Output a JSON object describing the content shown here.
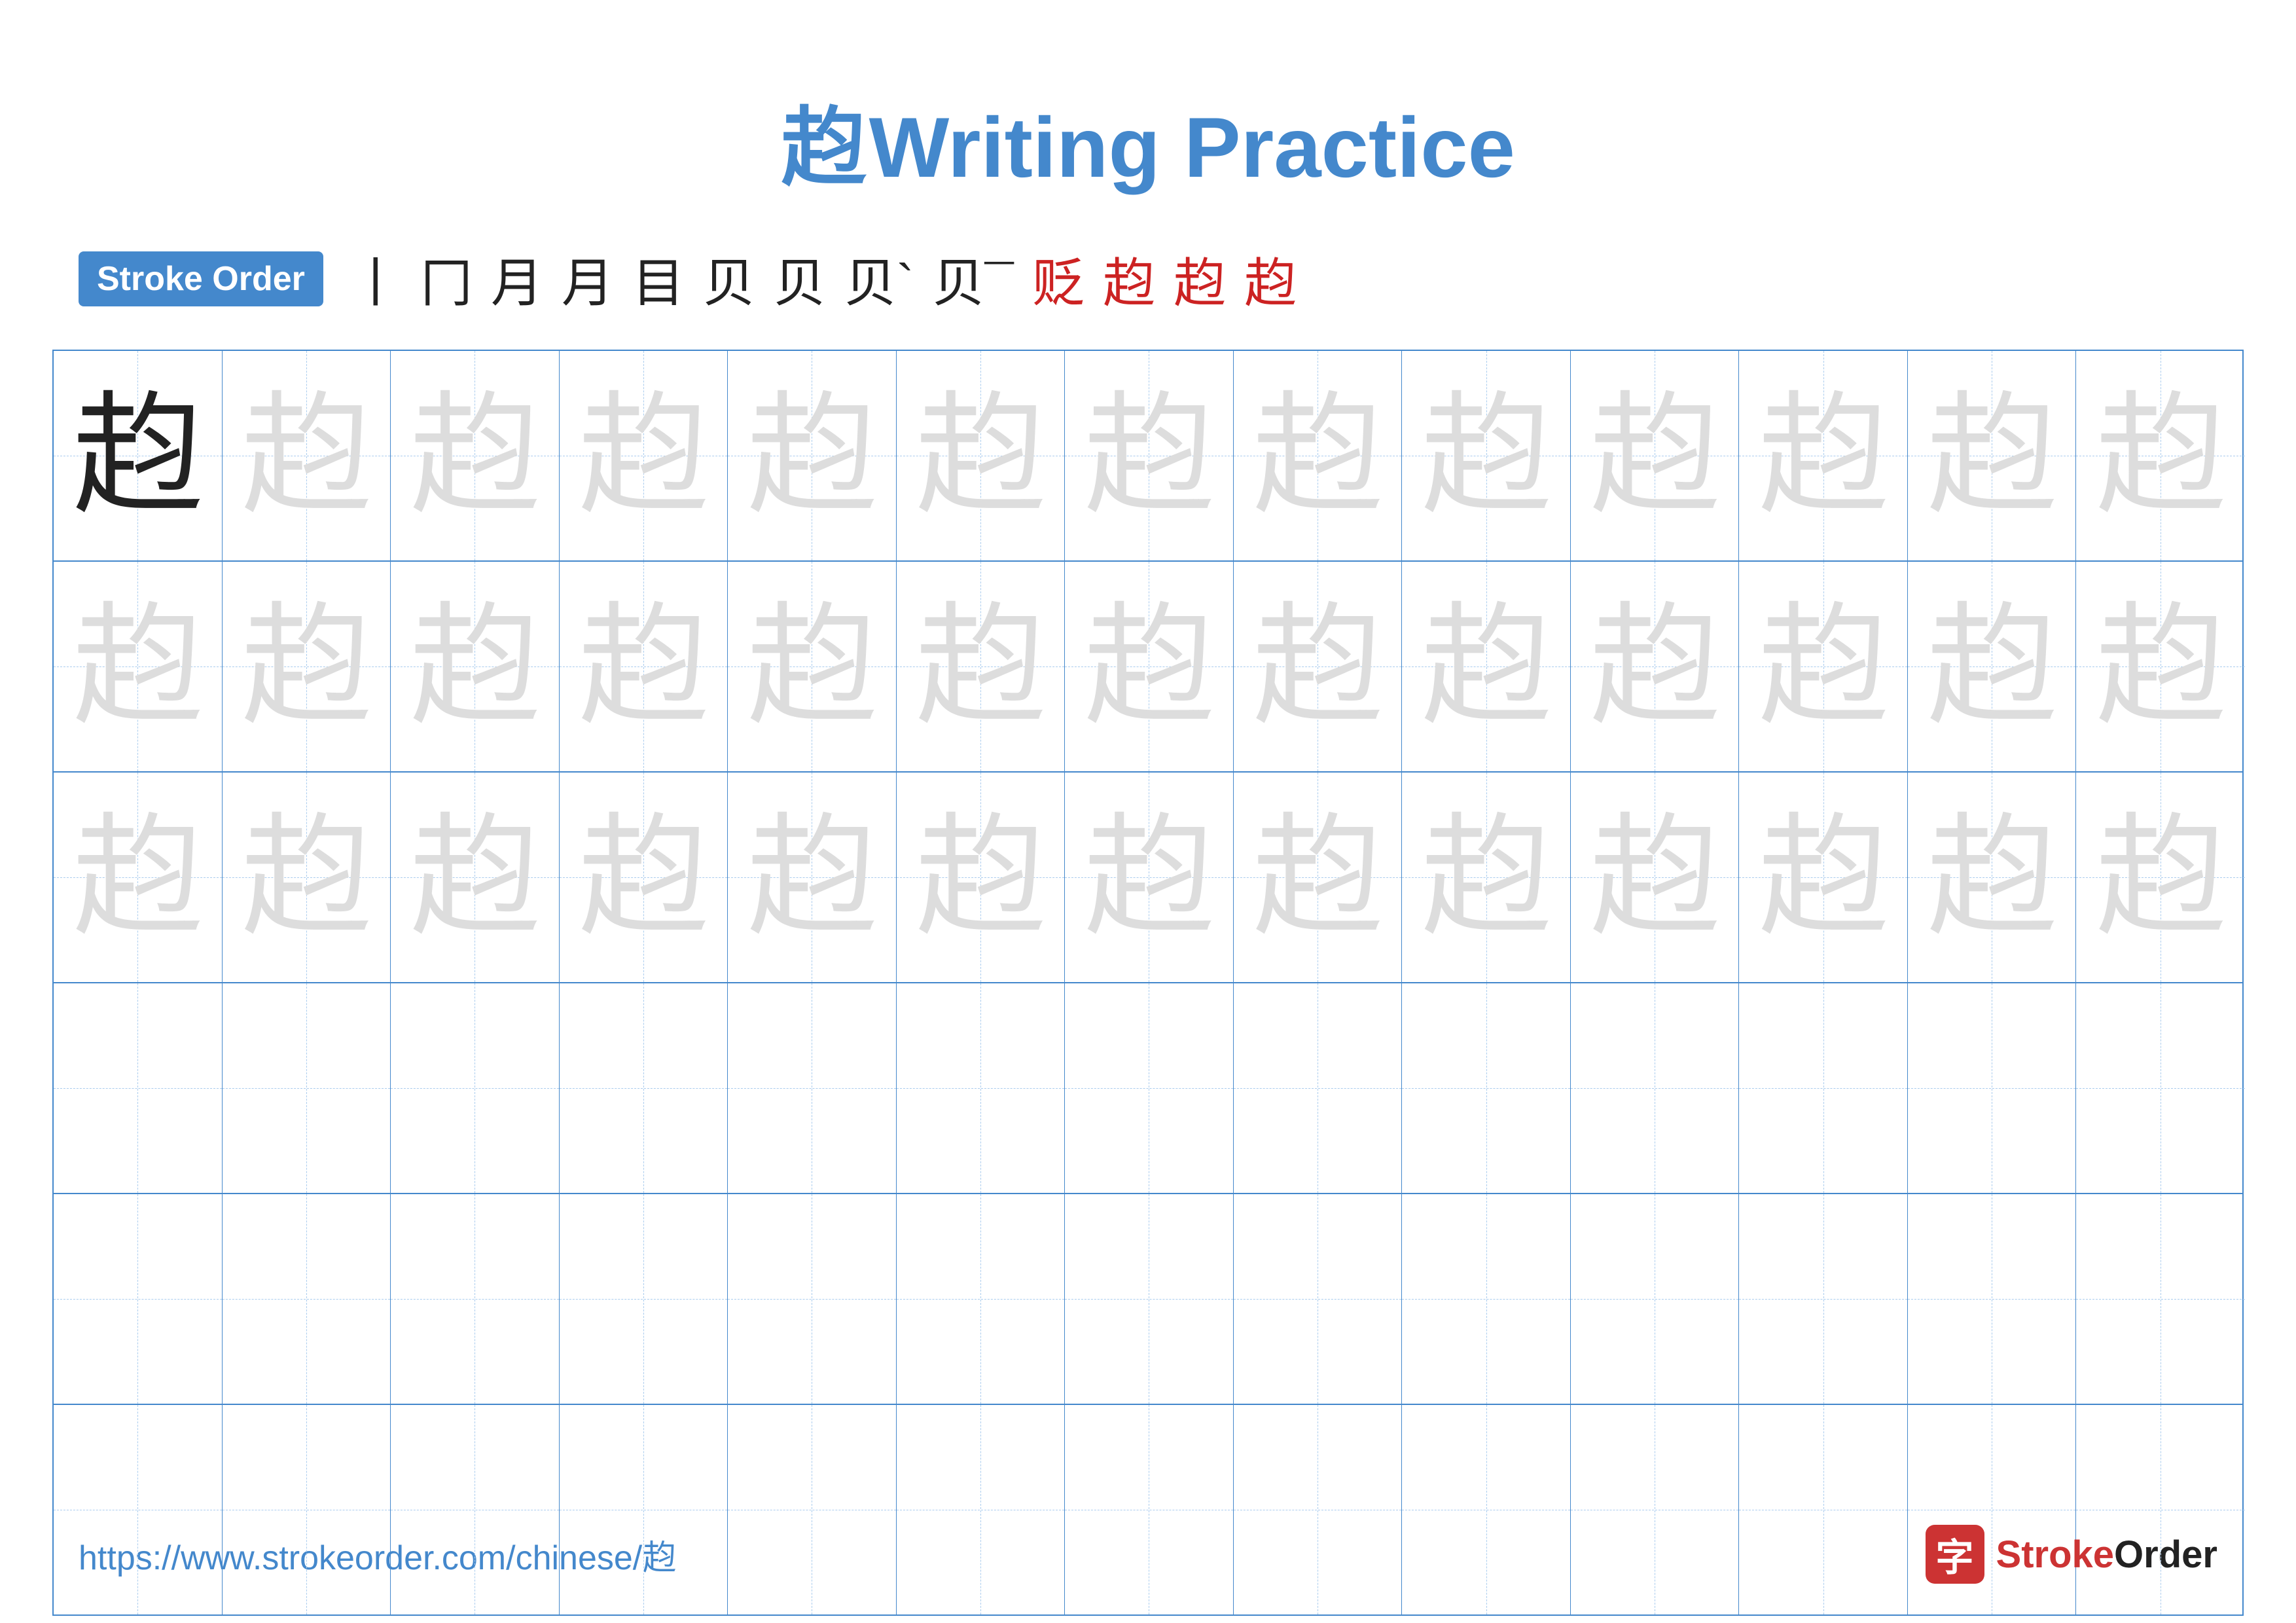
{
  "title": {
    "chinese": "赹",
    "english": "Writing Practice",
    "full": "赹 Writing Practice"
  },
  "stroke_order": {
    "badge_label": "Stroke Order",
    "strokes": [
      "丨",
      "冂",
      "月",
      "月",
      "目",
      "贝",
      "贝",
      "贝`",
      "贝一",
      "贬",
      "赹",
      "赹",
      "赹"
    ]
  },
  "grid": {
    "character": "赹",
    "rows": 6,
    "cols": 13,
    "filled_rows": 3
  },
  "footer": {
    "url": "https://www.strokeorder.com/chinese/赹",
    "logo_text": "StrokeOrder"
  }
}
